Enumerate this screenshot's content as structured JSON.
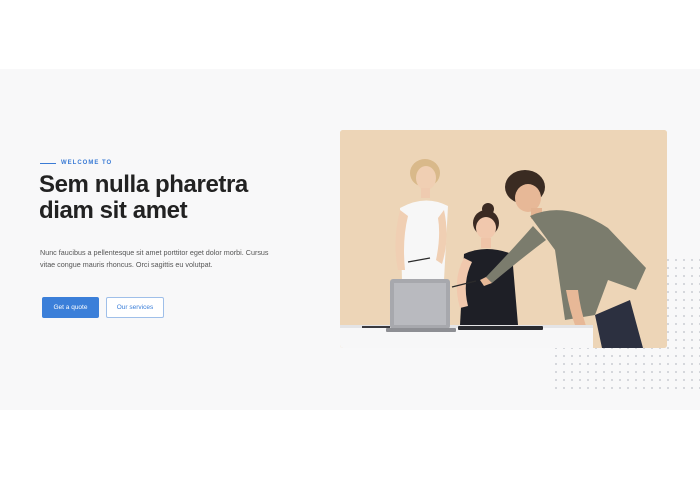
{
  "hero": {
    "eyebrow": "WELCOME TO",
    "title": "Sem nulla pharetra diam sit amet",
    "description": "Nunc faucibus a pellentesque sit amet porttitor eget dolor morbi. Cursus vitae congue mauris rhoncus. Orci sagittis eu volutpat.",
    "primary_button": "Get a quote",
    "secondary_button": "Our services"
  },
  "colors": {
    "accent": "#3b7fd9",
    "hero_background": "#f8f8f9",
    "photo_background": "#ecd2b2"
  }
}
